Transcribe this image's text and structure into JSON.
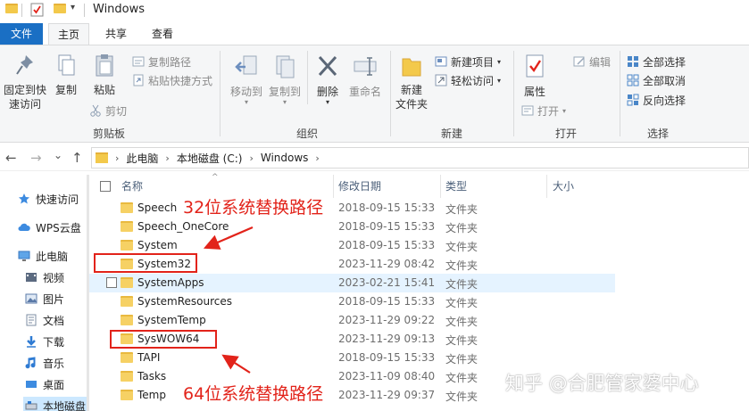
{
  "window": {
    "title": "Windows",
    "qa_dropdown": "▾"
  },
  "tabs": [
    {
      "label": "文件"
    },
    {
      "label": "主页"
    },
    {
      "label": "共享"
    },
    {
      "label": "查看"
    }
  ],
  "ribbon": {
    "clipboard": {
      "pin_line1": "固定到快",
      "pin_line2": "速访问",
      "copy": "复制",
      "paste": "粘贴",
      "copy_path": "复制路径",
      "paste_shortcut": "粘贴快捷方式",
      "cut": "剪切",
      "group": "剪贴板"
    },
    "organize": {
      "move_to": "移动到",
      "copy_to": "复制到",
      "delete": "删除",
      "rename": "重命名",
      "group": "组织"
    },
    "new": {
      "new_folder_line1": "新建",
      "new_folder_line2": "文件夹",
      "new_item": "新建项目",
      "easy_access": "轻松访问",
      "group": "新建"
    },
    "open": {
      "properties": "属性",
      "open": "打开",
      "edit": "编辑",
      "group": "打开"
    },
    "select": {
      "select_all": "全部选择",
      "select_none": "全部取消",
      "invert": "反向选择",
      "group": "选择"
    },
    "dropdown_glyph": "▾"
  },
  "nav": {
    "back": "←",
    "forward": "→",
    "recent": "⌄",
    "up": "↑",
    "breadcrumbs": [
      "此电脑",
      "本地磁盘 (C:)",
      "Windows"
    ],
    "crumb_sep": "›"
  },
  "sidebar": {
    "items": [
      {
        "label": "快速访问"
      },
      {
        "label": "WPS云盘"
      },
      {
        "label": "此电脑"
      },
      {
        "label": "视频"
      },
      {
        "label": "图片"
      },
      {
        "label": "文档"
      },
      {
        "label": "下载"
      },
      {
        "label": "音乐"
      },
      {
        "label": "桌面"
      },
      {
        "label": "本地磁盘"
      }
    ]
  },
  "filelist": {
    "columns": {
      "name": "名称",
      "date": "修改日期",
      "type": "类型",
      "size": "大小"
    },
    "sort_glyph": "^",
    "rows": [
      {
        "name": "Speech",
        "date": "2018-09-15 15:33",
        "type": "文件夹"
      },
      {
        "name": "Speech_OneCore",
        "date": "2018-09-15 15:33",
        "type": "文件夹"
      },
      {
        "name": "System",
        "date": "2018-09-15 15:33",
        "type": "文件夹"
      },
      {
        "name": "System32",
        "date": "2023-11-29 08:42",
        "type": "文件夹"
      },
      {
        "name": "SystemApps",
        "date": "2023-02-21 15:41",
        "type": "文件夹"
      },
      {
        "name": "SystemResources",
        "date": "2018-09-15 15:33",
        "type": "文件夹"
      },
      {
        "name": "SystemTemp",
        "date": "2023-11-29 09:22",
        "type": "文件夹"
      },
      {
        "name": "SysWOW64",
        "date": "2023-11-29 09:13",
        "type": "文件夹"
      },
      {
        "name": "TAPI",
        "date": "2018-09-15 15:33",
        "type": "文件夹"
      },
      {
        "name": "Tasks",
        "date": "2023-11-09 08:40",
        "type": "文件夹"
      },
      {
        "name": "Temp",
        "date": "2023-11-29 09:37",
        "type": "文件夹"
      }
    ]
  },
  "annotations": {
    "path32": "32位系统替换路径",
    "path64": "64位系统替换路径",
    "color": "#e2231a"
  },
  "watermark": "知乎 @合肥管家婆中心"
}
